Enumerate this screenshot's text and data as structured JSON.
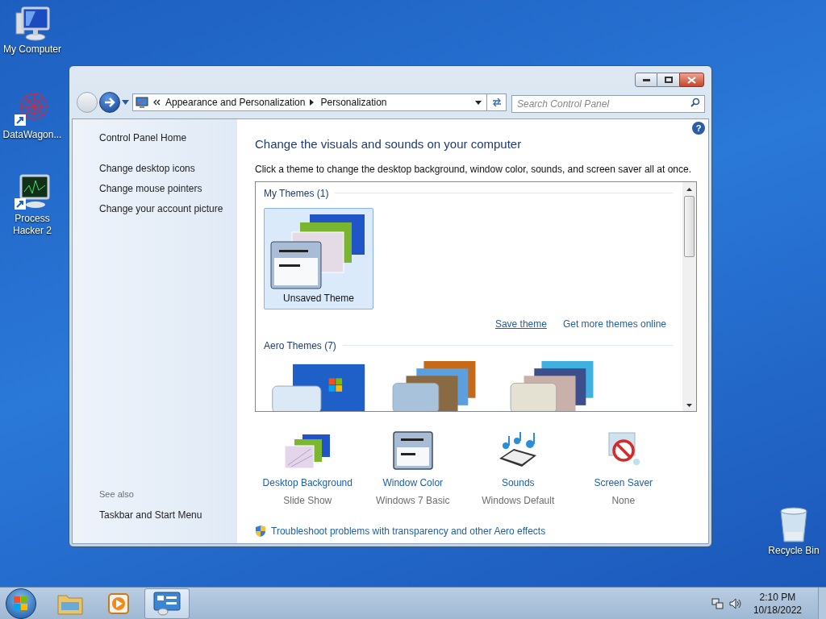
{
  "desktop_icons": [
    {
      "kind": "computer",
      "label": "My Computer"
    },
    {
      "kind": "datawagon",
      "label": "DataWagon..."
    },
    {
      "kind": "monitor",
      "label": "Process Hacker 2"
    },
    {
      "kind": "recycle",
      "label": "Recycle Bin"
    }
  ],
  "window": {
    "nav": {
      "breadcrumb": [
        "Appearance and Personalization",
        "Personalization"
      ],
      "search": {
        "placeholder": "Search Control Panel"
      }
    },
    "sidebar": {
      "home": "Control Panel Home",
      "links": [
        "Change desktop icons",
        "Change mouse pointers",
        "Change your account picture"
      ],
      "see_also_heading": "See also",
      "see_also": [
        "Taskbar and Start Menu"
      ]
    },
    "content": {
      "help": "?",
      "title": "Change the visuals and sounds on your computer",
      "description": "Click a theme to change the desktop background, window color, sounds, and screen saver all at once.",
      "theme_groups": [
        {
          "heading": "My Themes (1)",
          "themes": [
            {
              "kind": "basic",
              "label": "Unsaved Theme",
              "selected": true
            }
          ],
          "links": [
            "Save theme",
            "Get more themes online"
          ]
        },
        {
          "heading": "Aero Themes (7)",
          "themes": [
            {
              "kind": "windows",
              "selected": false
            },
            {
              "kind": "landscape",
              "selected": false
            },
            {
              "kind": "nature",
              "selected": false
            }
          ]
        }
      ],
      "settings": [
        {
          "kind": "background",
          "label": "Desktop Background",
          "value": "Slide Show"
        },
        {
          "kind": "color",
          "label": "Window Color",
          "value": "Windows 7 Basic"
        },
        {
          "kind": "sounds",
          "label": "Sounds",
          "value": "Windows Default"
        },
        {
          "kind": "screensaver",
          "label": "Screen Saver",
          "value": "None"
        }
      ],
      "troubleshoot": "Troubleshoot problems with transparency and other Aero effects"
    }
  },
  "taskbar": {
    "apps": [
      {
        "kind": "explorer",
        "selected": false
      },
      {
        "kind": "media",
        "selected": false
      },
      {
        "kind": "control",
        "selected": true
      }
    ],
    "time": "2:10 PM",
    "date": "10/18/2022"
  }
}
